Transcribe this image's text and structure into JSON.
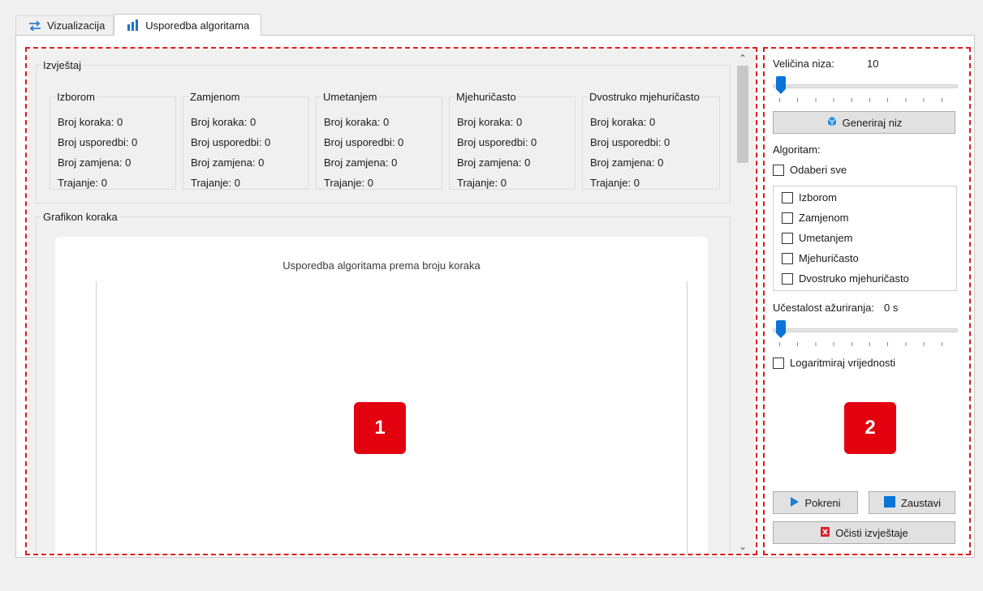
{
  "tabs": [
    {
      "label": "Vizualizacija",
      "icon": "swap-arrows-icon",
      "active": false
    },
    {
      "label": "Usporedba algoritama",
      "icon": "bar-chart-icon",
      "active": true
    }
  ],
  "report": {
    "title": "Izvještaj",
    "algorithms": [
      {
        "name": "Izborom",
        "steps": "Broj koraka: 0",
        "compares": "Broj usporedbi: 0",
        "swaps": "Broj zamjena: 0",
        "duration": "Trajanje: 0"
      },
      {
        "name": "Zamjenom",
        "steps": "Broj koraka: 0",
        "compares": "Broj usporedbi: 0",
        "swaps": "Broj zamjena: 0",
        "duration": "Trajanje: 0"
      },
      {
        "name": "Umetanjem",
        "steps": "Broj koraka: 0",
        "compares": "Broj usporedbi: 0",
        "swaps": "Broj zamjena: 0",
        "duration": "Trajanje: 0"
      },
      {
        "name": "Mjehuričasto",
        "steps": "Broj koraka: 0",
        "compares": "Broj usporedbi: 0",
        "swaps": "Broj zamjena: 0",
        "duration": "Trajanje: 0"
      },
      {
        "name": "Dvostruko mjehuričasto",
        "steps": "Broj koraka: 0",
        "compares": "Broj usporedbi: 0",
        "swaps": "Broj zamjena: 0",
        "duration": "Trajanje: 0"
      }
    ]
  },
  "graph": {
    "group_title": "Grafikon koraka",
    "chart_title": "Usporedba algoritama prema broju koraka"
  },
  "controls": {
    "array_size_label": "Veličina niza:",
    "array_size_value": "10",
    "array_size_slider_fraction": 0.0,
    "generate_button": "Generiraj niz",
    "algorithm_label": "Algoritam:",
    "select_all": "Odaberi sve",
    "algorithm_options": [
      "Izborom",
      "Zamjenom",
      "Umetanjem",
      "Mjehuričasto",
      "Dvostruko mjehuričasto"
    ],
    "update_freq_label": "Učestalost ažuriranja:",
    "update_freq_value": "0 s",
    "update_freq_slider_fraction": 0.0,
    "log_values": "Logaritmiraj vrijednosti",
    "start_button": "Pokreni",
    "stop_button": "Zaustavi",
    "clear_button": "Očisti izvještaje"
  },
  "annotations": {
    "badge_1": "1",
    "badge_2": "2",
    "color": "#e3000f"
  },
  "colors": {
    "slider_handle": "#0a74d9",
    "clear_icon": "#d9222a",
    "stop_icon": "#0a74d9"
  }
}
